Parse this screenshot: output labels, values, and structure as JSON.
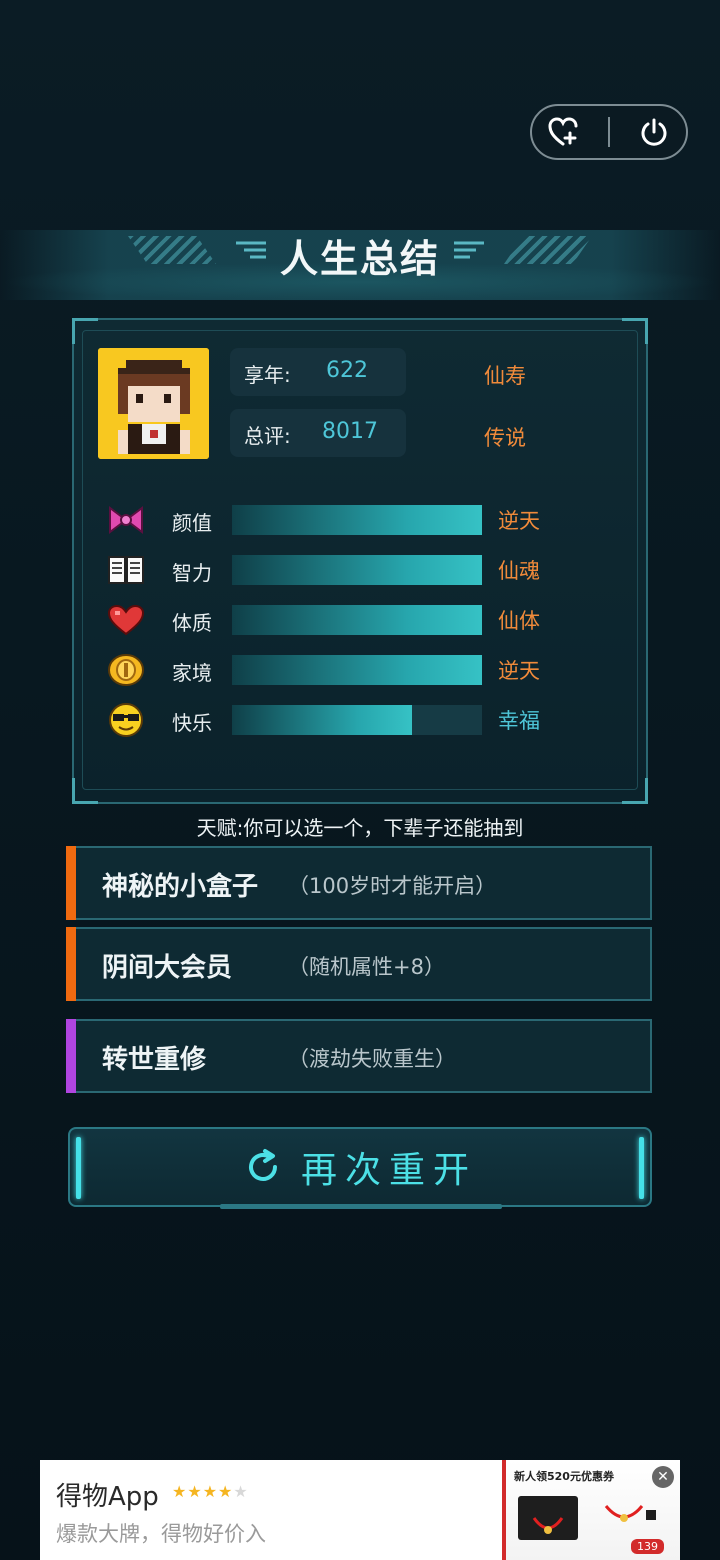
{
  "header": {
    "title": "人生总结"
  },
  "summary": {
    "age_label": "享年:",
    "age_value": "622",
    "age_rank": "仙寿",
    "score_label": "总评:",
    "score_value": "8017",
    "score_rank": "传说"
  },
  "attributes": [
    {
      "icon": "bow-icon",
      "label": "颜值",
      "fill": 1.0,
      "grade": "逆天",
      "grade_color": "#f08a3a"
    },
    {
      "icon": "book-icon",
      "label": "智力",
      "fill": 1.0,
      "grade": "仙魂",
      "grade_color": "#f08a3a"
    },
    {
      "icon": "heart-icon",
      "label": "体质",
      "fill": 1.0,
      "grade": "仙体",
      "grade_color": "#f08a3a"
    },
    {
      "icon": "coin-icon",
      "label": "家境",
      "fill": 1.0,
      "grade": "逆天",
      "grade_color": "#f08a3a"
    },
    {
      "icon": "sunglasses-emoji-icon",
      "label": "快乐",
      "fill": 0.72,
      "grade": "幸福",
      "grade_color": "#4ec6d8"
    }
  ],
  "talent_hint": "天赋:你可以选一个，下辈子还能抽到",
  "talents": [
    {
      "name": "神秘的小盒子",
      "desc": "（100岁时才能开启）",
      "color": "#f06a10"
    },
    {
      "name": "阴间大会员",
      "desc": "（随机属性+8）",
      "color": "#f06a10"
    },
    {
      "name": "转世重修",
      "desc": "（渡劫失败重生）",
      "color": "#b045e0"
    }
  ],
  "restart_label": "再次重开",
  "ad": {
    "name": "得物App",
    "slogan": "爆款大牌，得物好价入",
    "promo": "新人领520元优惠券",
    "price": "139"
  }
}
